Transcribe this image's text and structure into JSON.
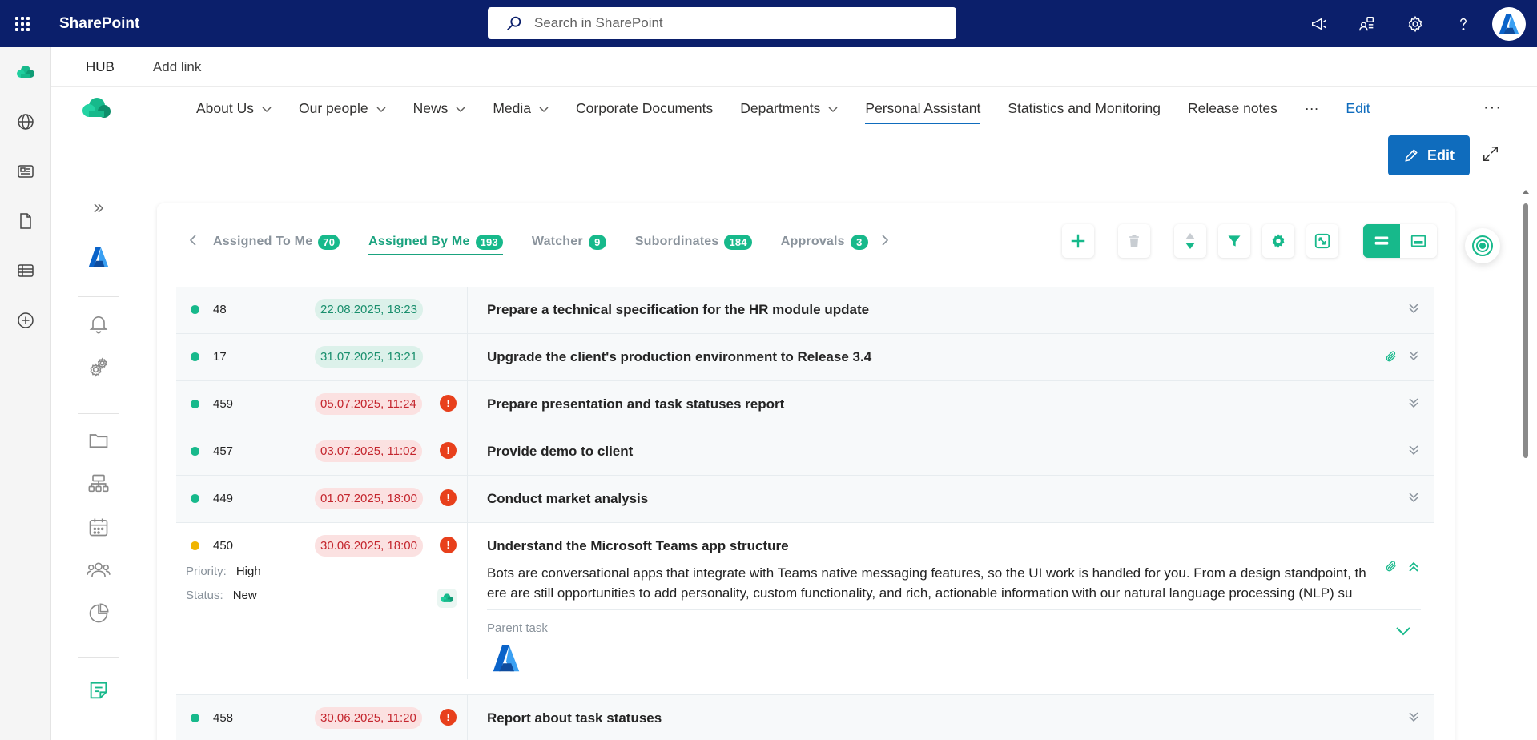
{
  "suite": {
    "brand": "SharePoint",
    "search_placeholder": "Search in SharePoint"
  },
  "hub": {
    "label": "HUB",
    "add_link": "Add link"
  },
  "site_nav": {
    "items": [
      {
        "label": "About Us",
        "dropdown": true
      },
      {
        "label": "Our people",
        "dropdown": true
      },
      {
        "label": "News",
        "dropdown": true
      },
      {
        "label": "Media",
        "dropdown": true
      },
      {
        "label": "Corporate Documents",
        "dropdown": false
      },
      {
        "label": "Departments",
        "dropdown": true
      },
      {
        "label": "Personal Assistant",
        "dropdown": false,
        "active": true
      },
      {
        "label": "Statistics and Monitoring",
        "dropdown": false
      },
      {
        "label": "Release notes",
        "dropdown": false
      }
    ],
    "overflow": "···",
    "edit": "Edit",
    "more": "···"
  },
  "page": {
    "edit_button": "Edit"
  },
  "tabs": [
    {
      "label": "Assigned To Me",
      "count": "70"
    },
    {
      "label": "Assigned By Me",
      "count": "193",
      "active": true
    },
    {
      "label": "Watcher",
      "count": "9"
    },
    {
      "label": "Subordinates",
      "count": "184"
    },
    {
      "label": "Approvals",
      "count": "3"
    }
  ],
  "tasks": [
    {
      "id": "48",
      "date": "22.08.2025, 18:23",
      "overdue": false,
      "title": "Prepare a technical specification for the HR module update",
      "attachment": false
    },
    {
      "id": "17",
      "date": "31.07.2025, 13:21",
      "overdue": false,
      "title": "Upgrade the client's production environment to Release 3.4",
      "attachment": true
    },
    {
      "id": "459",
      "date": "05.07.2025, 11:24",
      "overdue": true,
      "title": "Prepare presentation and task statuses report",
      "attachment": false
    },
    {
      "id": "457",
      "date": "03.07.2025, 11:02",
      "overdue": true,
      "title": "Provide demo to client",
      "attachment": false
    },
    {
      "id": "449",
      "date": "01.07.2025, 18:00",
      "overdue": true,
      "title": "Conduct market analysis",
      "attachment": false
    }
  ],
  "expanded_task": {
    "id": "450",
    "date": "30.06.2025, 18:00",
    "title": "Understand the Microsoft Teams app structure",
    "priority_label": "Priority:",
    "priority": "High",
    "status_label": "Status:",
    "status": "New",
    "description_line1": "Bots are conversational apps that integrate with Teams native messaging features, so the UI work is handled for you. From a design standpoint, th",
    "description_line2": "ere are still opportunities to add personality, custom functionality, and rich, actionable information with our natural language processing (NLP) su",
    "parent_label": "Parent task"
  },
  "last_task": {
    "id": "458",
    "date": "30.06.2025, 11:20",
    "overdue": true,
    "title": "Report about task statuses"
  },
  "colors": {
    "suite_bar": "#0b1f6b",
    "accent": "#17b98b",
    "primary": "#0f6cbd",
    "overdue": "#e8401c"
  }
}
